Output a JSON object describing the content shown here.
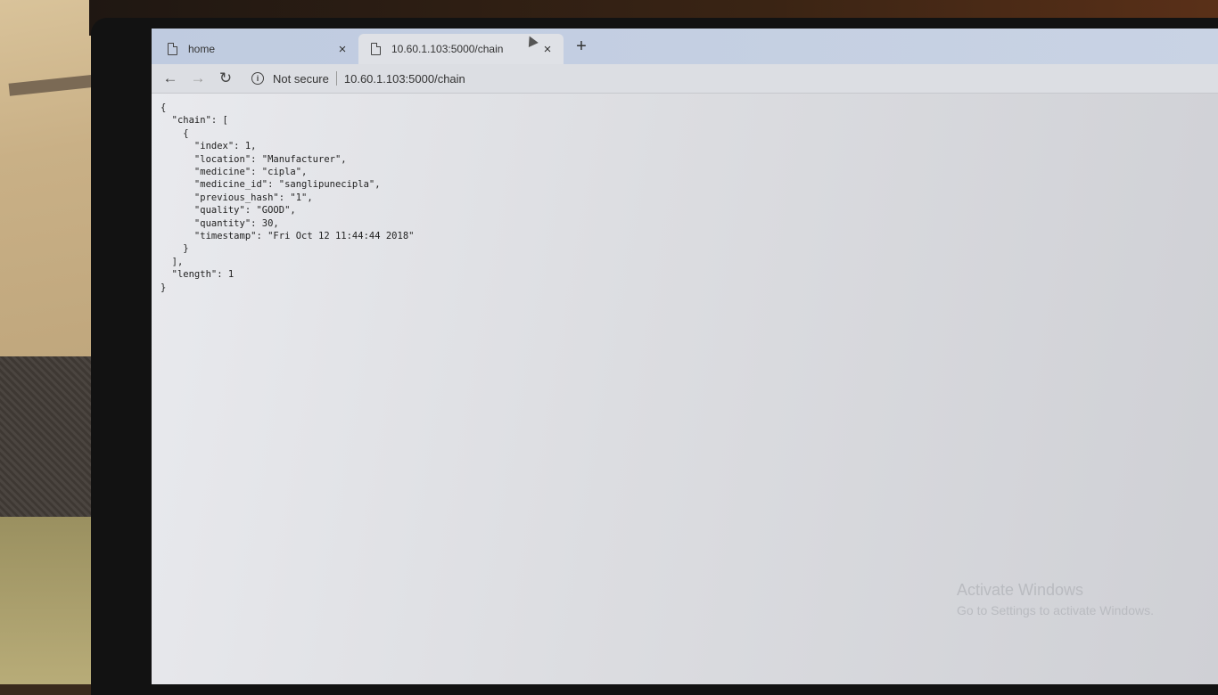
{
  "browser": {
    "tabs": [
      {
        "label": "home",
        "close": "×"
      },
      {
        "label": "10.60.1.103:5000/chain",
        "close": "×"
      }
    ],
    "new_tab": "+",
    "nav": {
      "back": "←",
      "forward": "→",
      "reload": "↻"
    },
    "omnibox": {
      "security_icon": "i",
      "security_label": "Not secure",
      "url": "10.60.1.103:5000/chain"
    }
  },
  "page": {
    "json_text": "{\n  \"chain\": [\n    {\n      \"index\": 1,\n      \"location\": \"Manufacturer\",\n      \"medicine\": \"cipla\",\n      \"medicine_id\": \"sanglipunecipla\",\n      \"previous_hash\": \"1\",\n      \"quality\": \"GOOD\",\n      \"quantity\": 30,\n      \"timestamp\": \"Fri Oct 12 11:44:44 2018\"\n    }\n  ],\n  \"length\": 1\n}"
  },
  "watermark": {
    "line1": "Activate Windows",
    "line2": "Go to Settings to activate Windows."
  }
}
